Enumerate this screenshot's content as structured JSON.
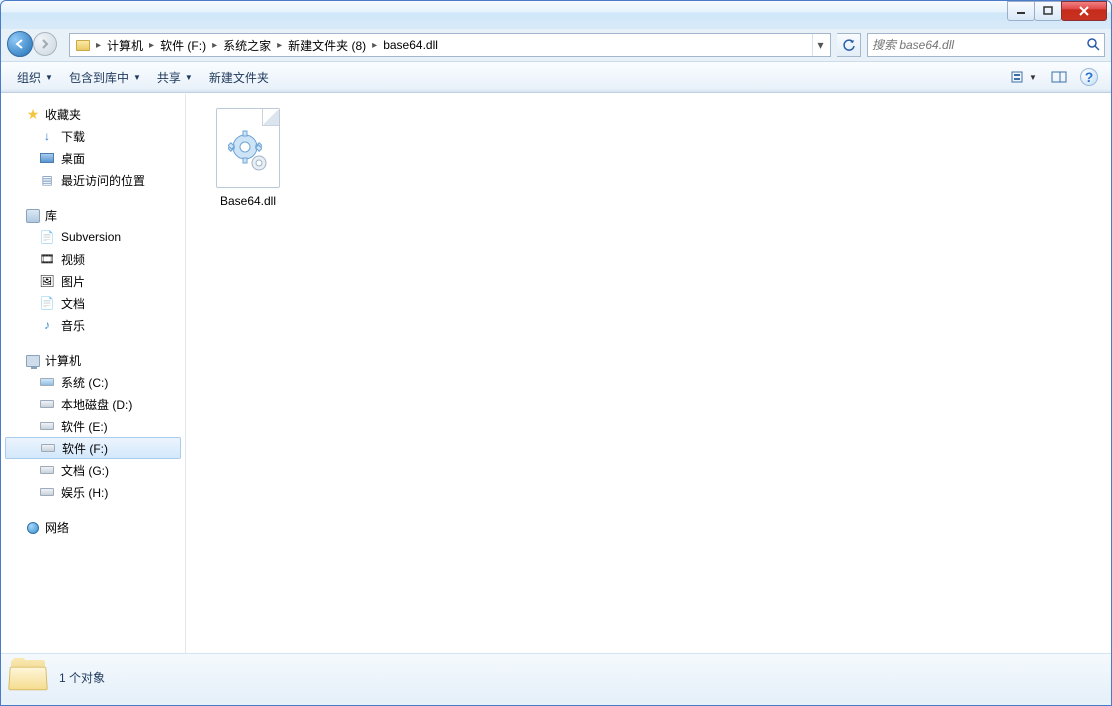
{
  "breadcrumb": {
    "items": [
      "计算机",
      "软件 (F:)",
      "系统之家",
      "新建文件夹 (8)",
      "base64.dll"
    ]
  },
  "search": {
    "placeholder": "搜索 base64.dll"
  },
  "toolbar": {
    "organize": "组织",
    "include": "包含到库中",
    "share": "共享",
    "newfolder": "新建文件夹"
  },
  "sidebar": {
    "favorites": {
      "label": "收藏夹",
      "items": [
        {
          "label": "下载"
        },
        {
          "label": "桌面"
        },
        {
          "label": "最近访问的位置"
        }
      ]
    },
    "libraries": {
      "label": "库",
      "items": [
        {
          "label": "Subversion"
        },
        {
          "label": "视频"
        },
        {
          "label": "图片"
        },
        {
          "label": "文档"
        },
        {
          "label": "音乐"
        }
      ]
    },
    "computer": {
      "label": "计算机",
      "items": [
        {
          "label": "系统 (C:)"
        },
        {
          "label": "本地磁盘 (D:)"
        },
        {
          "label": "软件 (E:)"
        },
        {
          "label": "软件 (F:)",
          "selected": true
        },
        {
          "label": "文档 (G:)"
        },
        {
          "label": "娱乐 (H:)"
        }
      ]
    },
    "network": {
      "label": "网络"
    }
  },
  "files": [
    {
      "name": "Base64.dll"
    }
  ],
  "status": {
    "text": "1 个对象"
  }
}
